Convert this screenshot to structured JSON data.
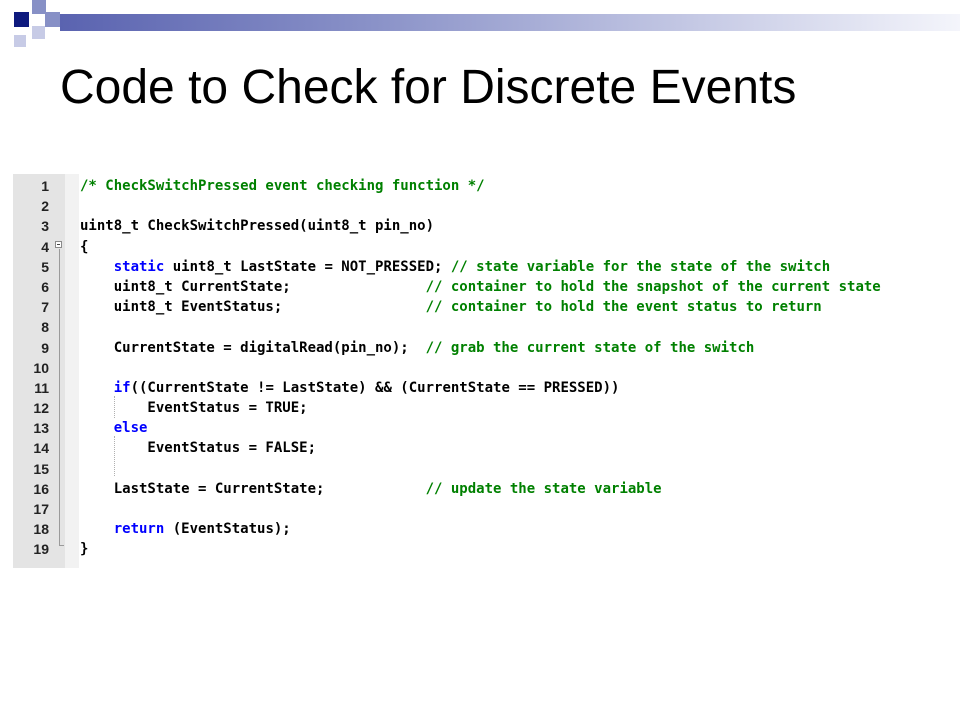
{
  "slide": {
    "title": "Code to Check for Discrete Events"
  },
  "colors": {
    "title_text": "#000000",
    "keyword": "#0000ff",
    "comment": "#008000",
    "code_text": "#000000",
    "gutter": "#e4e4e4",
    "corner_dark": "#0e1a7e",
    "corner_mid": "#8790c6"
  },
  "code": {
    "lines": [
      {
        "num": "1",
        "parts": [
          {
            "t": "/* CheckSwitchPressed event checking function */",
            "c": "cm"
          }
        ]
      },
      {
        "num": "2",
        "parts": []
      },
      {
        "num": "3",
        "parts": [
          {
            "t": "uint8_t CheckSwitchPressed(uint8_t pin_no)",
            "c": ""
          }
        ]
      },
      {
        "num": "4",
        "parts": [
          {
            "t": "{",
            "c": ""
          }
        ]
      },
      {
        "num": "5",
        "parts": [
          {
            "t": "    ",
            "c": ""
          },
          {
            "t": "static",
            "c": "kw"
          },
          {
            "t": " uint8_t LastState = NOT_PRESSED; ",
            "c": ""
          },
          {
            "t": "// state variable for the state of the switch",
            "c": "cm"
          }
        ]
      },
      {
        "num": "6",
        "parts": [
          {
            "t": "    uint8_t CurrentState;                ",
            "c": ""
          },
          {
            "t": "// container to hold the snapshot of the current state",
            "c": "cm"
          }
        ]
      },
      {
        "num": "7",
        "parts": [
          {
            "t": "    uint8_t EventStatus;                 ",
            "c": ""
          },
          {
            "t": "// container to hold the event status to return",
            "c": "cm"
          }
        ]
      },
      {
        "num": "8",
        "parts": []
      },
      {
        "num": "9",
        "parts": [
          {
            "t": "    CurrentState = digitalRead(pin_no);  ",
            "c": ""
          },
          {
            "t": "// grab the current state of the switch",
            "c": "cm"
          }
        ]
      },
      {
        "num": "10",
        "parts": []
      },
      {
        "num": "11",
        "parts": [
          {
            "t": "    ",
            "c": ""
          },
          {
            "t": "if",
            "c": "kw"
          },
          {
            "t": "((CurrentState != LastState) && (CurrentState == PRESSED))",
            "c": ""
          }
        ]
      },
      {
        "num": "12",
        "parts": [
          {
            "t": "        EventStatus = TRUE;",
            "c": ""
          }
        ]
      },
      {
        "num": "13",
        "parts": [
          {
            "t": "    ",
            "c": ""
          },
          {
            "t": "else",
            "c": "kw"
          }
        ]
      },
      {
        "num": "14",
        "parts": [
          {
            "t": "        EventStatus = FALSE;",
            "c": ""
          }
        ]
      },
      {
        "num": "15",
        "parts": []
      },
      {
        "num": "16",
        "parts": [
          {
            "t": "    LastState = CurrentState;            ",
            "c": ""
          },
          {
            "t": "// update the state variable",
            "c": "cm"
          }
        ]
      },
      {
        "num": "17",
        "parts": []
      },
      {
        "num": "18",
        "parts": [
          {
            "t": "    ",
            "c": ""
          },
          {
            "t": "return",
            "c": "kw"
          },
          {
            "t": " (EventStatus);",
            "c": ""
          }
        ]
      },
      {
        "num": "19",
        "parts": [
          {
            "t": "}",
            "c": ""
          }
        ]
      }
    ]
  }
}
